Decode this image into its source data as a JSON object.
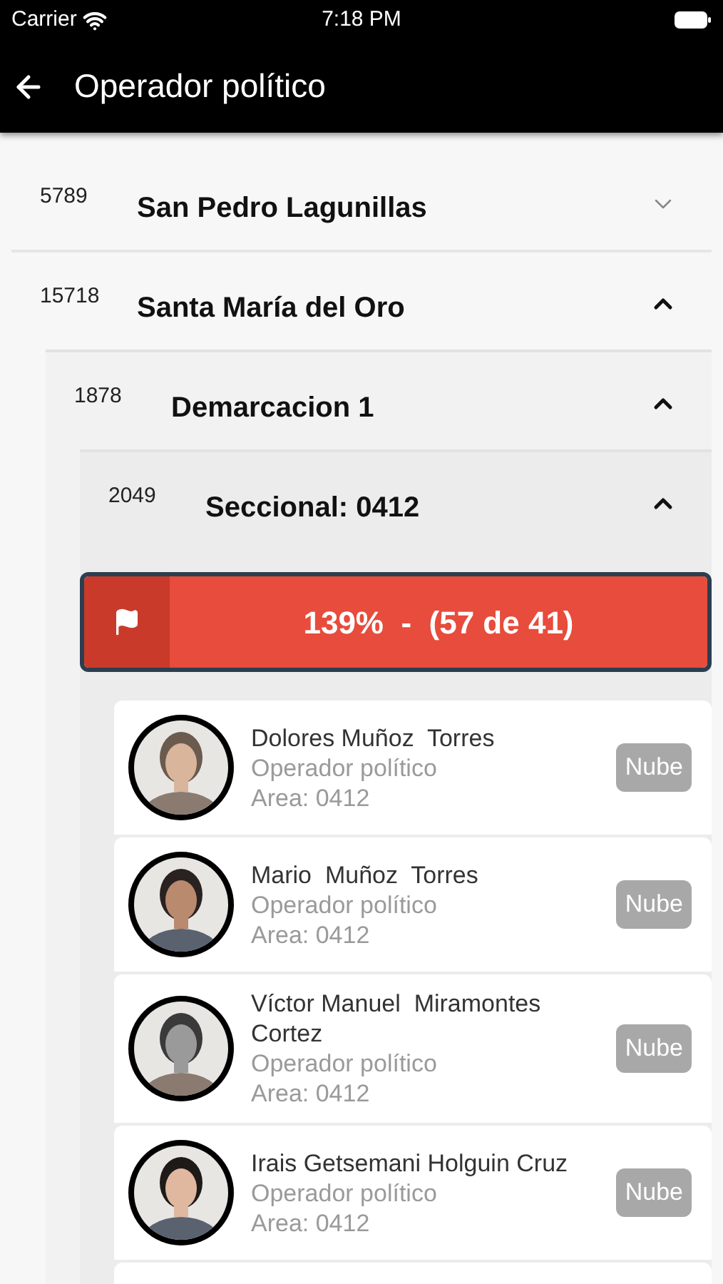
{
  "status_bar": {
    "carrier": "Carrier",
    "time": "7:18 PM"
  },
  "app_bar": {
    "title": "Operador político"
  },
  "tree": [
    {
      "code": "5789",
      "name": "San Pedro Lagunillas",
      "expanded": false
    },
    {
      "code": "15718",
      "name": "Santa María del Oro",
      "expanded": true,
      "children": [
        {
          "code": "1878",
          "name": "Demarcacion 1",
          "expanded": true,
          "children": [
            {
              "code": "2049",
              "name": "Seccional: 0412",
              "expanded": true,
              "progress": {
                "text": "139%  -  (57 de 41)"
              },
              "people": [
                {
                  "name": "Dolores Muñoz  Torres",
                  "role": "Operador político",
                  "area": "Area: 0412",
                  "badge": "Nube"
                },
                {
                  "name": "Mario  Muñoz  Torres",
                  "role": "Operador político",
                  "area": "Area: 0412",
                  "badge": "Nube"
                },
                {
                  "name": "Víctor Manuel  Miramontes Cortez",
                  "role": "Operador político",
                  "area": "Area: 0412",
                  "badge": "Nube"
                },
                {
                  "name": "Irais Getsemani Holguin Cruz",
                  "role": "Operador político",
                  "area": "Area: 0412",
                  "badge": "Nube"
                }
              ]
            }
          ]
        }
      ]
    }
  ]
}
